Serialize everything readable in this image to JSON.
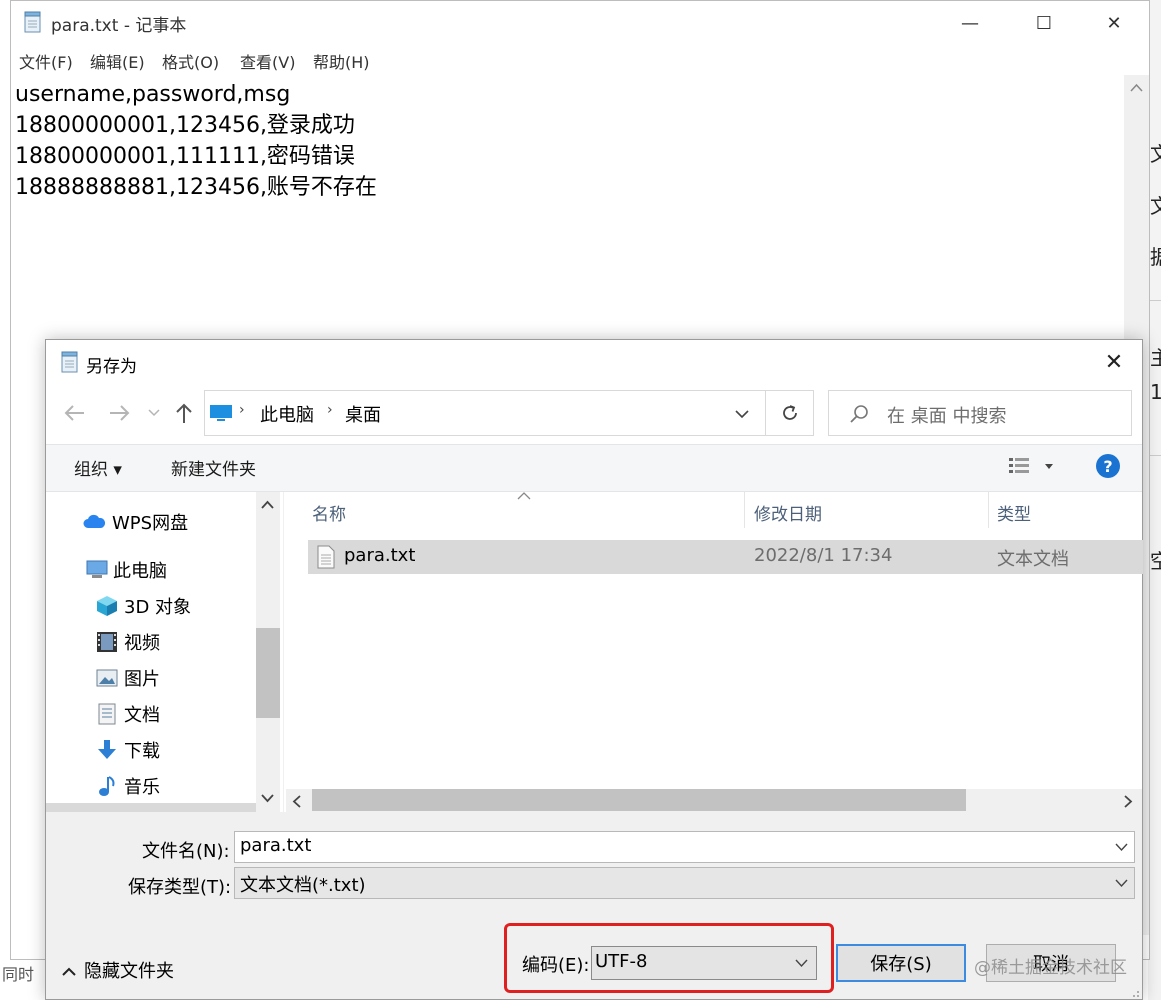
{
  "notepad": {
    "title": "para.txt - 记事本",
    "minimize": "—",
    "maximize": "☐",
    "close": "✕",
    "menus": [
      "文件(F)",
      "编辑(E)",
      "格式(O)",
      "查看(V)",
      "帮助(H)"
    ],
    "lines": [
      "username,password,msg",
      "18800000001,123456,登录成功",
      "18800000001,111111,密码错误",
      "18888888881,123456,账号不存在"
    ],
    "status_fragment": "同时"
  },
  "background_fragments": [
    "文",
    "文",
    "据",
    "主",
    "1",
    "空"
  ],
  "dialog": {
    "title": "另存为",
    "close": "✕",
    "breadcrumb": [
      "此电脑",
      "桌面"
    ],
    "search_placeholder": "在 桌面 中搜索",
    "toolbar": {
      "organize": "组织 ▾",
      "new_folder": "新建文件夹",
      "help": "?"
    },
    "nav_items": [
      {
        "label": "WPS网盘",
        "icon": "cloud-icon"
      },
      {
        "label": "此电脑",
        "icon": "computer-icon"
      },
      {
        "label": "3D 对象",
        "icon": "cube-icon"
      },
      {
        "label": "视频",
        "icon": "video-icon"
      },
      {
        "label": "图片",
        "icon": "picture-icon"
      },
      {
        "label": "文档",
        "icon": "document-icon"
      },
      {
        "label": "下载",
        "icon": "download-icon"
      },
      {
        "label": "音乐",
        "icon": "music-icon"
      }
    ],
    "columns": {
      "name": "名称",
      "modified": "修改日期",
      "type": "类型"
    },
    "files": [
      {
        "name": "para.txt",
        "modified": "2022/8/1 17:34",
        "type": "文本文档"
      }
    ],
    "filename_label": "文件名(N):",
    "filename_value": "para.txt",
    "filetype_label": "保存类型(T):",
    "filetype_value": "文本文档(*.txt)",
    "hide_folders": "隐藏文件夹",
    "encoding_label": "编码(E):",
    "encoding_value": "UTF-8",
    "save_button": "保存(S)",
    "cancel_button": "取消",
    "watermark": "@稀土掘金技术社区"
  }
}
